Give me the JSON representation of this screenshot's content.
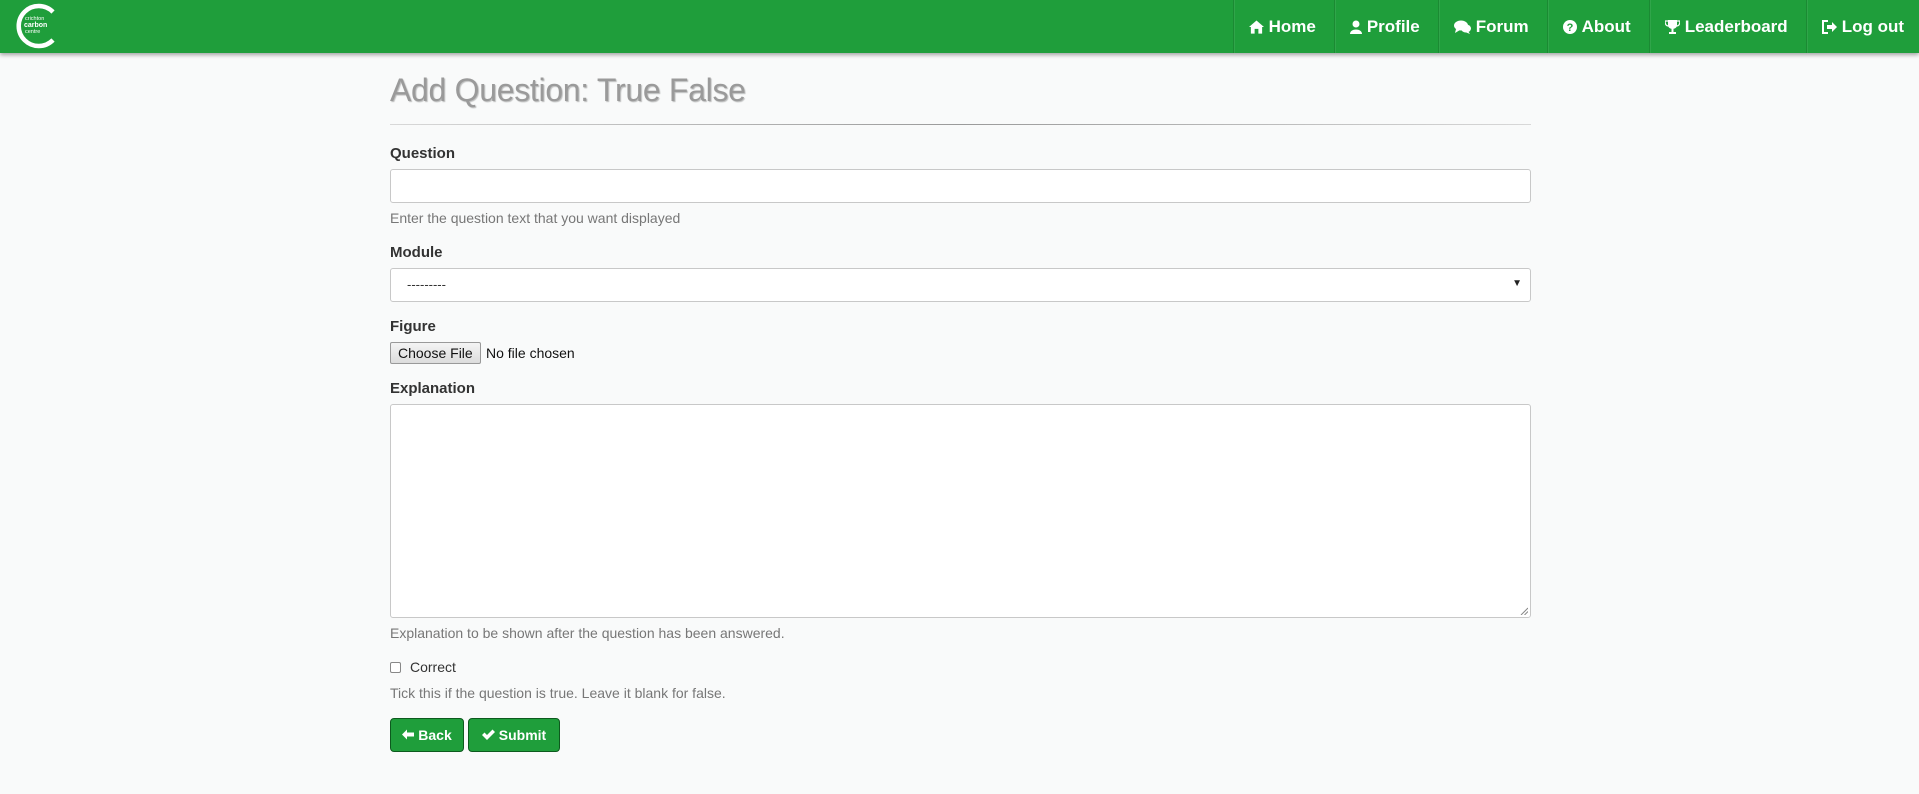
{
  "brand": {
    "logo_lines": [
      "crichton",
      "carbon",
      "centre"
    ],
    "color": "#1f9e3b"
  },
  "nav": [
    {
      "label": "Home",
      "icon": "home-icon"
    },
    {
      "label": "Profile",
      "icon": "user-icon"
    },
    {
      "label": "Forum",
      "icon": "comments-icon"
    },
    {
      "label": "About",
      "icon": "question-circle-icon"
    },
    {
      "label": "Leaderboard",
      "icon": "trophy-icon"
    },
    {
      "label": "Log out",
      "icon": "sign-out-icon"
    }
  ],
  "page": {
    "title": "Add Question: True False"
  },
  "form": {
    "question": {
      "label": "Question",
      "value": "",
      "help": "Enter the question text that you want displayed"
    },
    "module": {
      "label": "Module",
      "selected": "---------"
    },
    "figure": {
      "label": "Figure",
      "button": "Choose File",
      "status": "No file chosen"
    },
    "explanation": {
      "label": "Explanation",
      "value": "",
      "help": "Explanation to be shown after the question has been answered."
    },
    "correct": {
      "label": "Correct",
      "checked": false,
      "help": "Tick this if the question is true. Leave it blank for false."
    }
  },
  "actions": {
    "back": "Back",
    "submit": "Submit"
  }
}
